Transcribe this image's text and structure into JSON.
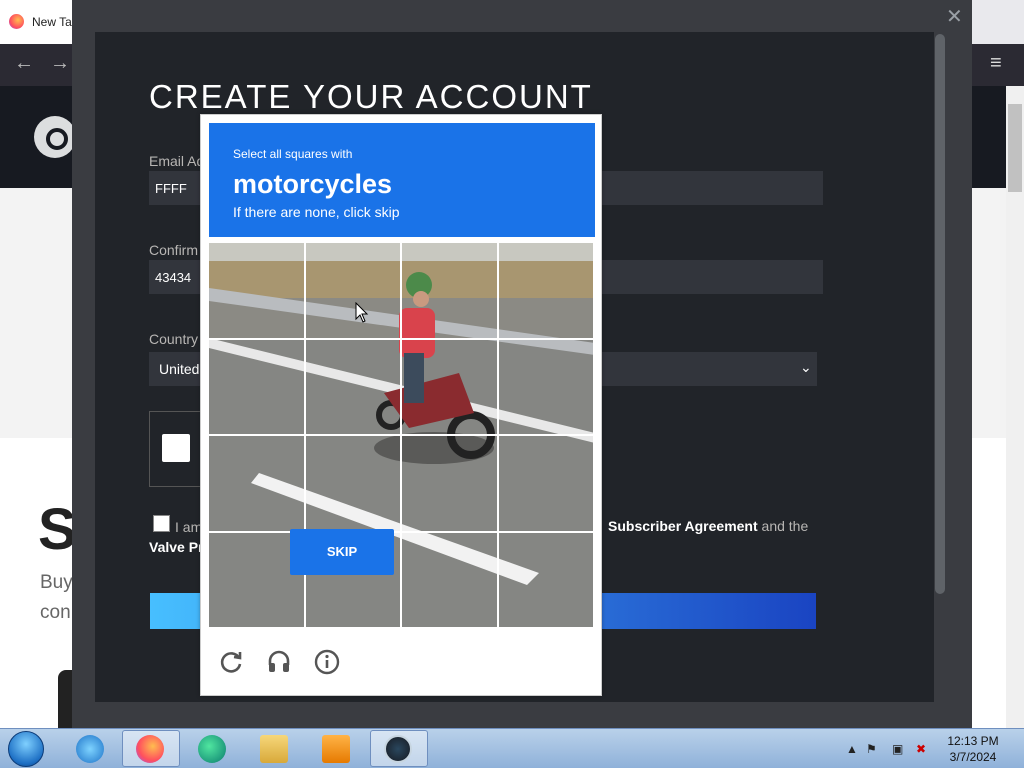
{
  "browser": {
    "tab_title": "New Ta",
    "back_glyph": "←",
    "forward_glyph": "→",
    "menu_glyph": "≡"
  },
  "background_page": {
    "big_letter": "S",
    "buy_line1": "Buy",
    "buy_line2": "con"
  },
  "modal": {
    "close_glyph": "✕",
    "title": "CREATE YOUR ACCOUNT",
    "email_label": "Email Ad",
    "email_value": "FFFF",
    "confirm_label": "Confirm",
    "confirm_value": "43434",
    "country_label": "Country",
    "country_value": "United",
    "agree_prefix": "I am",
    "agree_link1": "Subscriber Agreement",
    "agree_mid": " and the",
    "agree_link2": "Valve Pr"
  },
  "captcha": {
    "instruction_small": "Select all squares with",
    "target": "motorcycles",
    "instruction_sub": "If there are none, click skip",
    "skip_label": "SKIP",
    "icons": [
      "reload-icon",
      "audio-icon",
      "info-icon"
    ],
    "grid_rows": 4,
    "grid_cols": 4,
    "header_color": "#1a73e8"
  },
  "taskbar": {
    "time": "12:13 PM",
    "date": "3/7/2024",
    "apps": [
      "ie-icon",
      "firefox-icon",
      "edge-icon",
      "explorer-icon",
      "media-player-icon",
      "steam-icon"
    ]
  }
}
